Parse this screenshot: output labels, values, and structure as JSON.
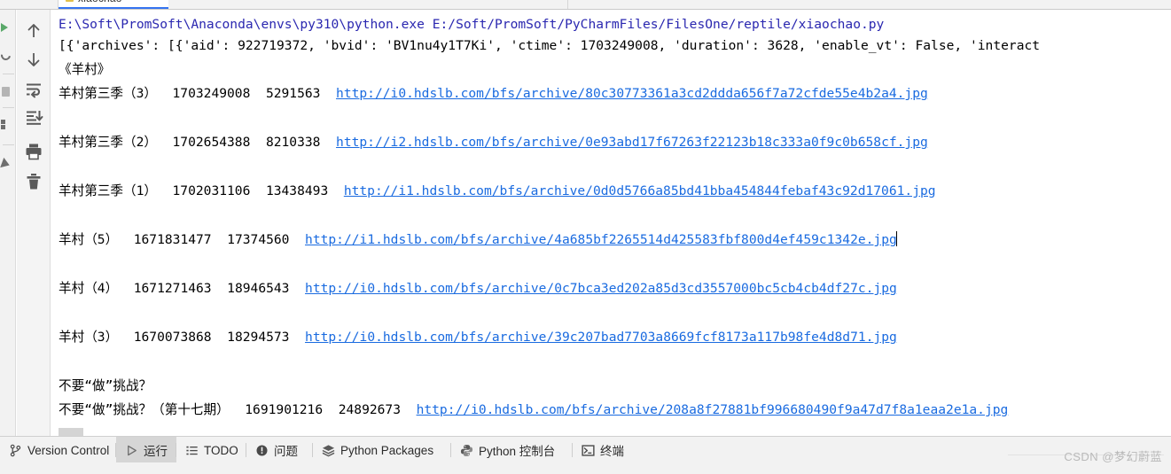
{
  "window": {
    "tab": {
      "label": "xiaochao",
      "close_glyph": "×",
      "icon": "python-file-icon"
    }
  },
  "run_toolbar": {
    "items": [
      {
        "name": "rerun-button",
        "icon": "play-icon"
      },
      {
        "name": "rerun-failed-button",
        "icon": "rerun-icon"
      },
      {
        "name": "stop-button",
        "icon": "stop-icon"
      },
      {
        "name": "layout-button",
        "icon": "layers-icon"
      },
      {
        "name": "pin-button",
        "icon": "cursor-icon"
      }
    ]
  },
  "console_toolbar": {
    "items": [
      {
        "name": "scroll-up-button",
        "icon": "arrow-up-icon",
        "tooltip": "Up the stack trace"
      },
      {
        "name": "scroll-down-button",
        "icon": "arrow-down-icon",
        "tooltip": "Down the stack trace"
      },
      {
        "name": "soft-wrap-button",
        "icon": "soft-wrap-icon",
        "tooltip": "Soft-Wrap"
      },
      {
        "name": "scroll-to-end-button",
        "icon": "scroll-to-end-icon",
        "tooltip": "Scroll to End"
      },
      {
        "name": "print-button",
        "icon": "printer-icon",
        "tooltip": "Print"
      },
      {
        "name": "clear-all-button",
        "icon": "trash-icon",
        "tooltip": "Clear All"
      }
    ]
  },
  "console": {
    "lines": [
      {
        "id": "command-line",
        "kind": "command",
        "segments": [
          {
            "style": "cmd",
            "text": "E:\\Soft\\PromSoft\\Anaconda\\envs\\py310\\python.exe E:/Soft/PromSoft/PyCharmFiles/FilesOne/reptile/xiaochao.py"
          }
        ]
      },
      {
        "id": "payload-line",
        "kind": "text",
        "segments": [
          {
            "style": "plain",
            "text": "[{'archives': [{'aid': 922719372, 'bvid': 'BV1nu4y1T7Ki', 'ctime': 1703249008, 'duration': 3628, 'enable_vt': False, 'interact"
          }
        ]
      },
      {
        "id": "series-title-yangcun",
        "kind": "text",
        "segments": [
          {
            "style": "plain",
            "text": "《羊村》"
          }
        ]
      },
      {
        "id": "row-yangcun-s3-3",
        "kind": "row",
        "segments": [
          {
            "style": "plain",
            "text": "羊村第三季（3）  1703249008  5291563  "
          },
          {
            "style": "link",
            "text": "http://i0.hdslb.com/bfs/archive/80c30773361a3cd2ddda656f7a72cfde55e4b2a4.jpg"
          }
        ]
      },
      {
        "id": "row-yangcun-s3-2",
        "kind": "row",
        "segments": [
          {
            "style": "plain",
            "text": "羊村第三季（2）  1702654388  8210338  "
          },
          {
            "style": "link",
            "text": "http://i2.hdslb.com/bfs/archive/0e93abd17f67263f22123b18c333a0f9c0b658cf.jpg"
          }
        ]
      },
      {
        "id": "row-yangcun-s3-1",
        "kind": "row",
        "segments": [
          {
            "style": "plain",
            "text": "羊村第三季（1）  1702031106  13438493  "
          },
          {
            "style": "link",
            "text": "http://i1.hdslb.com/bfs/archive/0d0d5766a85bd41bba454844febaf43c92d17061.jpg"
          }
        ]
      },
      {
        "id": "row-yangcun-5",
        "kind": "row",
        "caret": true,
        "segments": [
          {
            "style": "plain",
            "text": "羊村（5）  1671831477  17374560  "
          },
          {
            "style": "link",
            "text": "http://i1.hdslb.com/bfs/archive/4a685bf2265514d425583fbf800d4ef459c1342e.jpg"
          }
        ]
      },
      {
        "id": "row-yangcun-4",
        "kind": "row",
        "segments": [
          {
            "style": "plain",
            "text": "羊村（4）  1671271463  18946543  "
          },
          {
            "style": "link",
            "text": "http://i0.hdslb.com/bfs/archive/0c7bca3ed202a85d3cd3557000bc5cb4cb4df27c.jpg"
          }
        ]
      },
      {
        "id": "row-yangcun-3",
        "kind": "row",
        "segments": [
          {
            "style": "plain",
            "text": "羊村（3）  1670073868  18294573  "
          },
          {
            "style": "link",
            "text": "http://i0.hdslb.com/bfs/archive/39c207bad7703a8669fcf8173a117b98fe4d8d71.jpg"
          }
        ]
      },
      {
        "id": "series-title-buyaozuo",
        "kind": "text",
        "segments": [
          {
            "style": "plain",
            "text": "不要“做”挑战？"
          }
        ]
      },
      {
        "id": "row-buyaozuo-17",
        "kind": "row",
        "segments": [
          {
            "style": "plain",
            "text": "不要“做”挑战？（第十七期）  1691901216  24892673  "
          },
          {
            "style": "link",
            "text": "http://i0.hdslb.com/bfs/archive/208a8f27881bf996680490f9a47d7f8a1eaa2e1a.jpg"
          }
        ]
      }
    ]
  },
  "bottom_bar": {
    "items": [
      {
        "name": "tool-window-version-control",
        "label": "Version Control",
        "icon": "branch-icon",
        "active": false
      },
      {
        "name": "tool-window-run",
        "label": "运行",
        "icon": "play-icon",
        "active": true
      },
      {
        "name": "tool-window-todo",
        "label": "TODO",
        "icon": "list-icon",
        "active": false
      },
      {
        "name": "tool-window-problems",
        "label": "问题",
        "icon": "warning-icon",
        "active": false
      },
      {
        "name": "tool-window-python-packages",
        "label": "Python Packages",
        "icon": "packages-icon",
        "active": false
      },
      {
        "name": "tool-window-python-console",
        "label": "Python 控制台",
        "icon": "python-icon",
        "active": false
      },
      {
        "name": "tool-window-terminal",
        "label": "终端",
        "icon": "terminal-icon",
        "active": false
      }
    ]
  },
  "watermark": {
    "text": "CSDN @梦幻蔚蓝"
  },
  "colors": {
    "command_text": "#2a27b0",
    "link_text": "#1a6be0",
    "body_text": "#000000",
    "tab_accent": "#3574f0",
    "chrome_bg": "#f2f2f2",
    "console_bg": "#ffffff",
    "active_tool_bg": "#d6d6d6"
  }
}
